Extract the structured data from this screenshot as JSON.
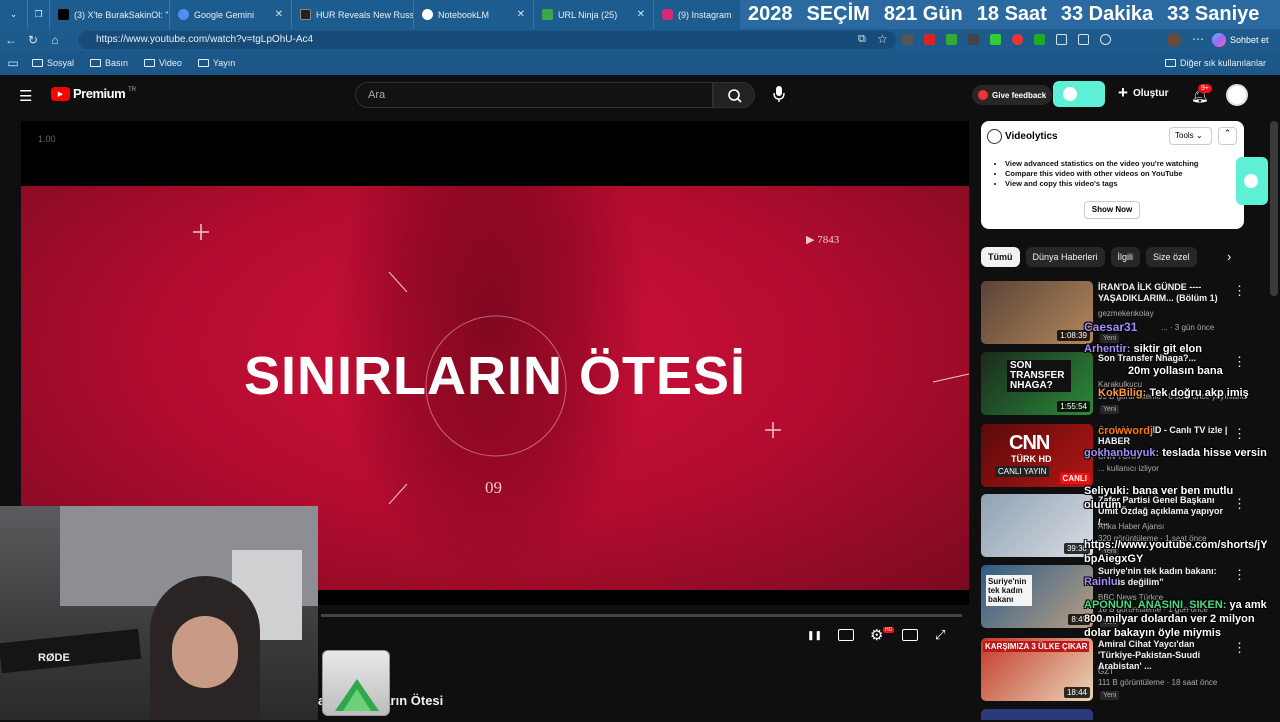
{
  "browser": {
    "tabs": [
      {
        "label": "(3) X'te BurakSakinOl: \"",
        "color": "#000000"
      },
      {
        "label": "Google Gemini",
        "color": "#4f8ef7"
      },
      {
        "label": "HUR Reveals New Russ",
        "color": "#222222"
      },
      {
        "label": "NotebookLM",
        "color": "#ffffff"
      },
      {
        "label": "URL Ninja (25)",
        "color": "#3aa84a"
      },
      {
        "label": "(9) Instagram",
        "color": "#d62976"
      }
    ],
    "countdown": [
      "2028",
      "SEÇİM",
      "821 Gün",
      "18 Saat",
      "33 Dakika",
      "33 Saniye"
    ],
    "url": "https://www.youtube.com/watch?v=tgLpOhU-Ac4",
    "chat_button": "Sohbet et",
    "bookmarks": [
      "Sosyal",
      "Basın",
      "Video",
      "Yayın"
    ],
    "other_bookmarks": "Diğer sık kullanılanlar"
  },
  "youtube": {
    "logo": "Premium",
    "logo_region": "TR",
    "search_placeholder": "Ara",
    "feedback": "Give feedback",
    "create": "Oluştur",
    "notif_count": "9+"
  },
  "player": {
    "speed": "1.00",
    "overlay_title": "SINIRLARIN ÖTESİ",
    "overlay_views": "7843",
    "overlay_number": "09",
    "video_title": "Sınırların Ötesi",
    "video_title_prefix": "an"
  },
  "videolytics": {
    "title": "Videolytics",
    "tools": "Tools",
    "features": [
      "View advanced statistics on the video you're watching",
      "Compare this video with other videos on YouTube",
      "View and copy this video's tags"
    ],
    "button": "Show Now"
  },
  "chips": [
    "Tümü",
    "Dünya Haberleri",
    "İlgili",
    "Size özel"
  ],
  "recommendations": [
    {
      "title": "İRAN'DA İLK GÜNDE ---- YAŞADIKLARIM... (Bölüm 1)",
      "channel": "gezmekenkolay",
      "meta": "... · 3 gün önce",
      "badge": "Yeni",
      "duration": "1:08:39",
      "thumb": "#7a5a48"
    },
    {
      "title": "Son Transfer Nhaga?...",
      "channel": "Karakulkucu",
      "meta": "99 B görüntüleme · 8 saat önce yayınlandı",
      "badge": "Yeni",
      "duration": "1:55:54",
      "thumb": "#2c6a3a"
    },
    {
      "title": "Canlı Yayın HD - Canlı TV izle | HABER",
      "channel": "CNN TÜRK",
      "meta": "... kullanıcı izliyor",
      "badge": "",
      "duration": "CANLI",
      "thumb": "#8a1010"
    },
    {
      "title": "Zafer Partisi Genel Başkanı Ümit Özdağ açıklama yapıyor /...",
      "channel": "Anka Haber Ajansı",
      "meta": "320 görüntüleme · 1 saat önce",
      "badge": "Yeni",
      "duration": "39:30",
      "thumb": "#a9b4c0"
    },
    {
      "title": "Suriye'nin tek kadın bakanı: \"...süs değilim\"",
      "channel": "BBC News Türkçe",
      "meta": "18 B görüntüleme · 1 gün önce",
      "badge": "Yeni",
      "duration": "8:49",
      "thumb": "#3a6f9c"
    },
    {
      "title": "Amiral Cihat Yaycı'dan 'Türkiye-Pakistan-Suudi Arabistan' ...",
      "channel": "GZT",
      "meta": "111 B görüntüleme · 18 saat önce",
      "badge": "Yeni",
      "duration": "18:44",
      "thumb": "#c33a2a"
    }
  ],
  "thumb_texts": {
    "son_transfer": "SON TRANSFER NHAGA?",
    "cnn": "CNN",
    "turk": "TÜRK HD",
    "canli_yayin": "CANLI YAYIN",
    "suriye": "Suriye'nin tek kadın bakanı",
    "karsimiza": "KARŞIMIZA 3 ÜLKE ÇIKAR"
  },
  "chat_messages": [
    {
      "user": "Caesar31",
      "text": "",
      "color": "#a78bfa"
    },
    {
      "user": "Arhentir:",
      "text": "siktir git elon",
      "color": "#a78bfa"
    },
    {
      "user": "",
      "text": "20m yollasın bana",
      "color": "#ffffff"
    },
    {
      "user": "KokBilig:",
      "text": "Tek doğru akp imiş",
      "color": "#ff9a3c"
    },
    {
      "user": "crowwordj",
      "text": "",
      "color": "#ff7a00"
    },
    {
      "user": "gokhanbuyuk:",
      "text": "teslada hisse versin",
      "color": "#a78bfa"
    },
    {
      "user": "Seliyuki:",
      "text": "bana ver ben mutlu olurum",
      "color": "#ffffff"
    },
    {
      "user": "",
      "text": "https://www.youtube.com/shorts/jYbpAiegxGY",
      "color": "#ffffff"
    },
    {
      "user": "Rainlu",
      "text": "",
      "color": "#a78bfa"
    },
    {
      "user": "APONUN_ANASINI_SIKEN:",
      "text": "ya amk 800 milyar dolardan ver 2 milyon dolar bakayın öyle miymis",
      "color": "#4ade80"
    }
  ],
  "webcam": {
    "mic_brand": "RØDE"
  }
}
